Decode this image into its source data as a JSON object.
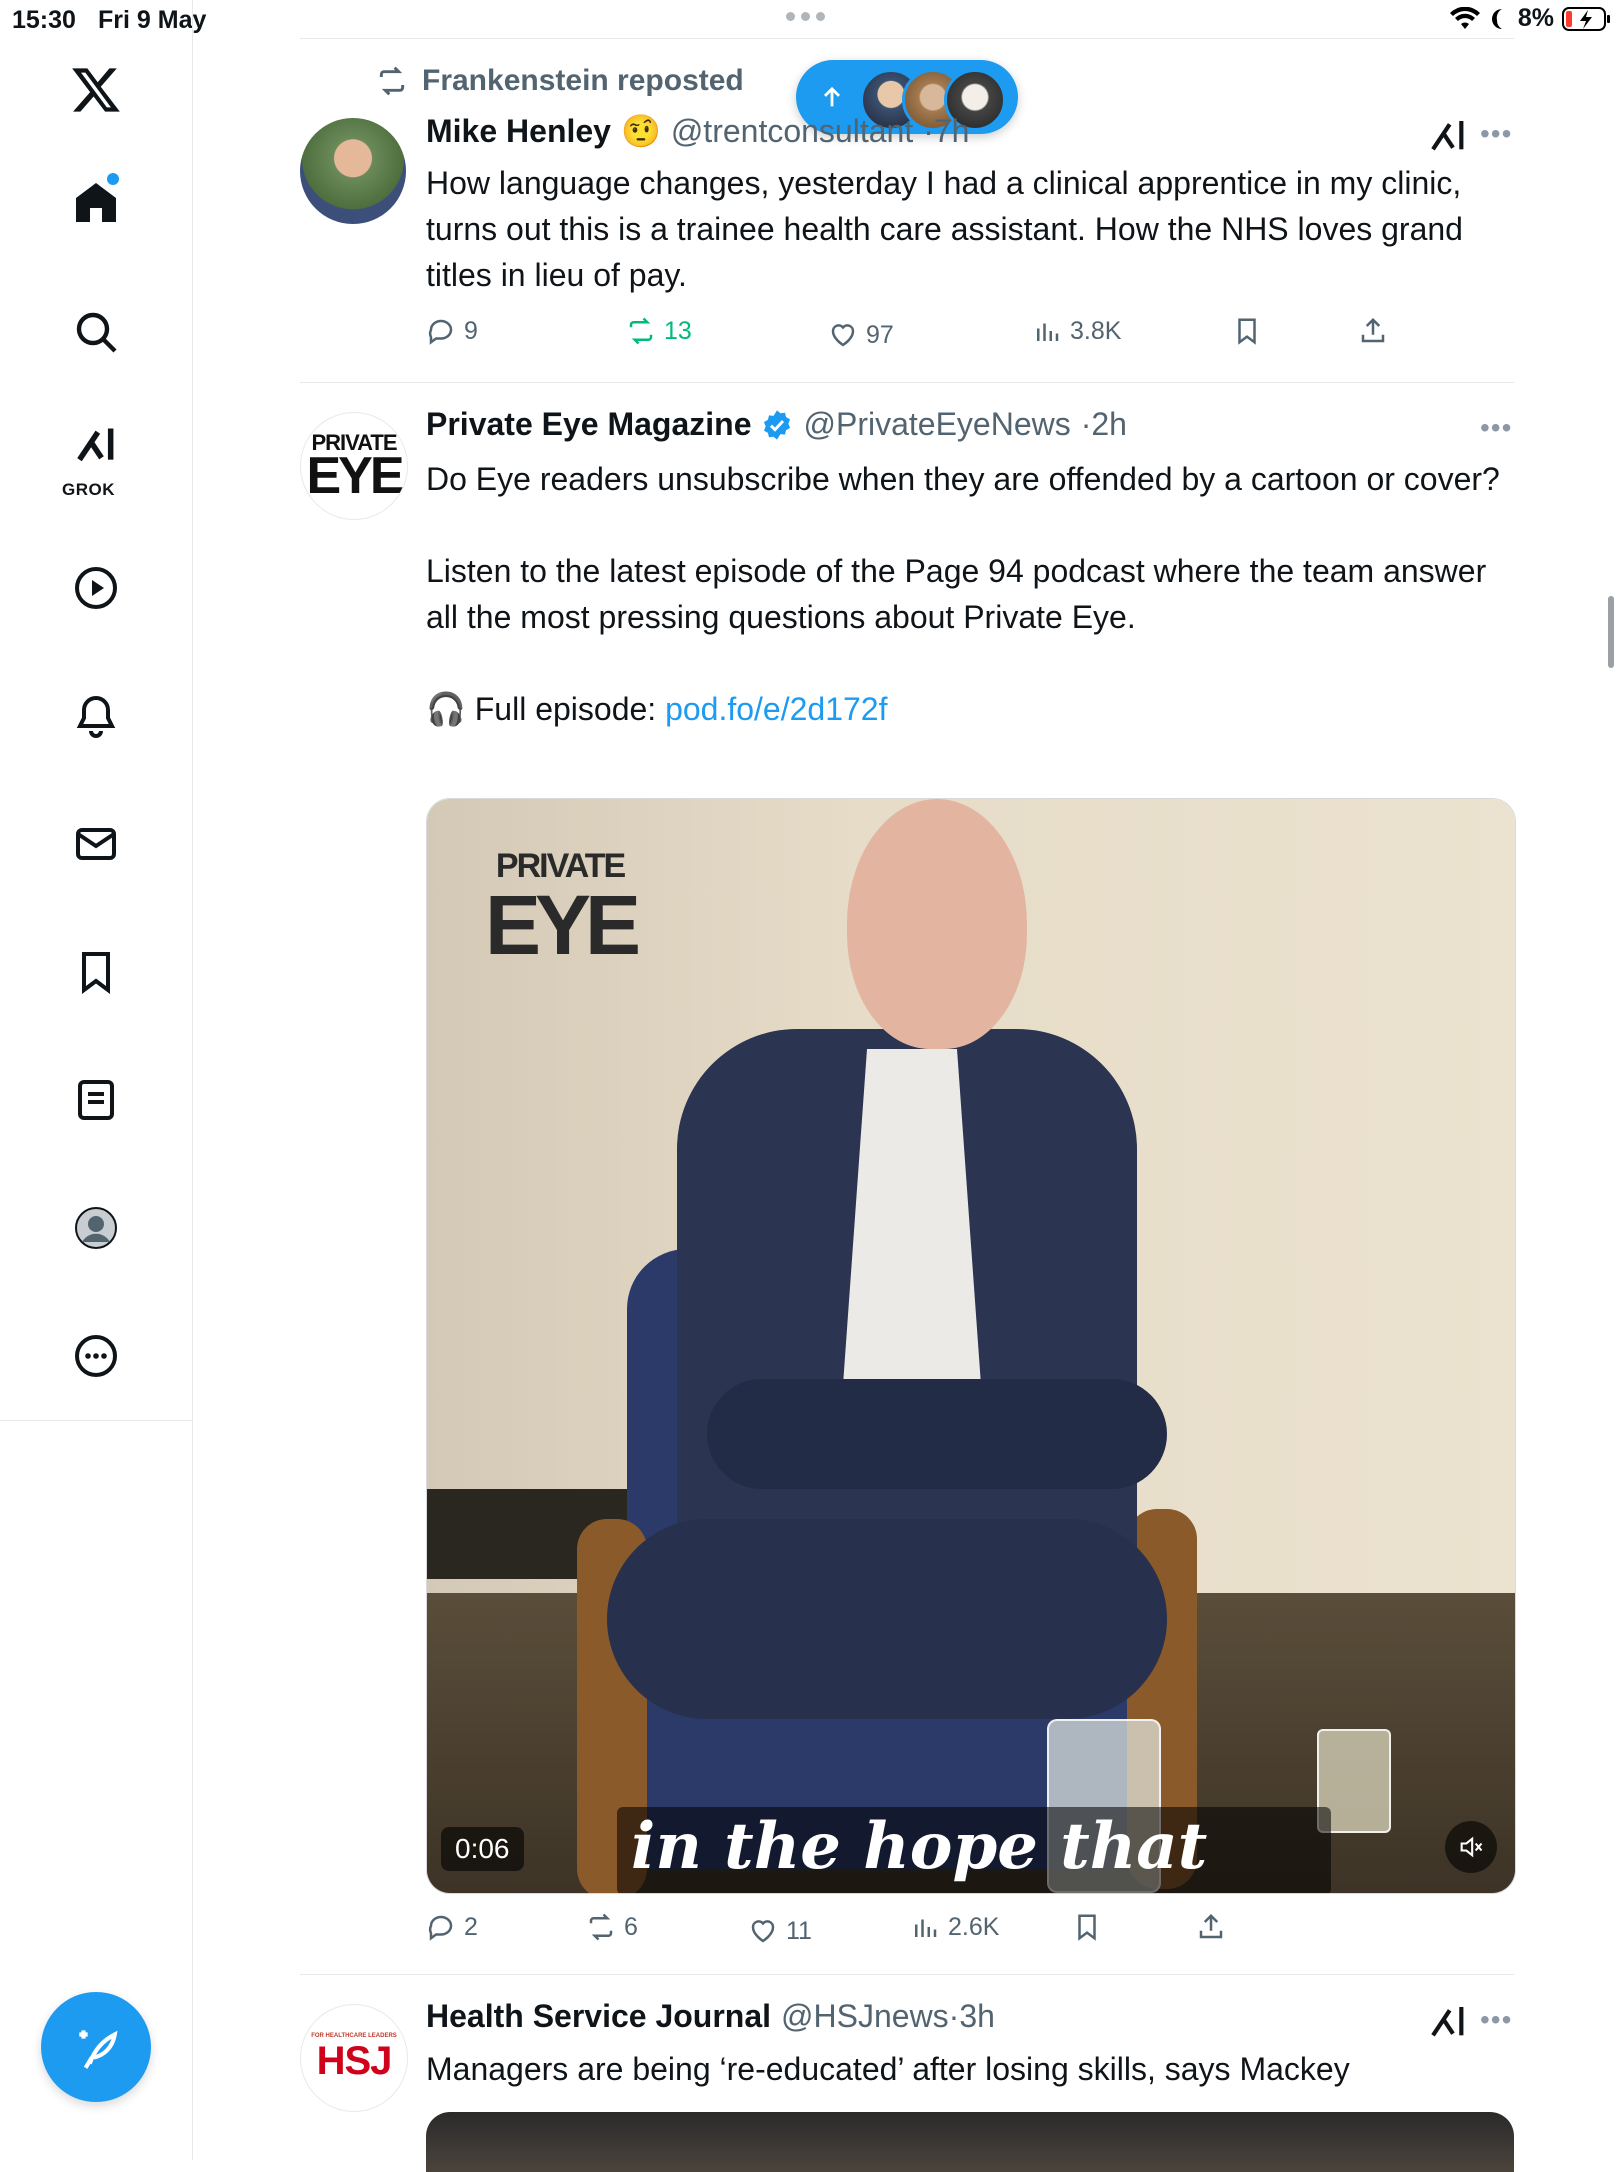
{
  "status_bar": {
    "time": "15:30",
    "date": "Fri 9 May",
    "battery": "8%"
  },
  "sidebar": {
    "grok_label": "GROK",
    "items": [
      {
        "name": "home",
        "icon": "home-icon"
      },
      {
        "name": "explore",
        "icon": "search-icon"
      },
      {
        "name": "grok",
        "icon": "grok-icon"
      },
      {
        "name": "video",
        "icon": "play-icon"
      },
      {
        "name": "notifications",
        "icon": "bell-icon"
      },
      {
        "name": "messages",
        "icon": "mail-icon"
      },
      {
        "name": "bookmarks",
        "icon": "bookmark-icon"
      },
      {
        "name": "lists",
        "icon": "list-icon"
      },
      {
        "name": "profile",
        "icon": "profile-icon"
      },
      {
        "name": "more",
        "icon": "more-circle-icon"
      }
    ],
    "compose_icon": "compose-icon"
  },
  "tweets": [
    {
      "reposted_by": "Frankenstein reposted",
      "name": "Mike Henley",
      "emoji": "🤨",
      "handle": "@trentconsultant",
      "time": "·7h",
      "text": "How language changes, yesterday I had a clinical apprentice in my clinic, turns out this is a trainee health care assistant. How the NHS loves grand titles in lieu of pay.",
      "replies": "9",
      "reposts": "13",
      "likes": "97",
      "views": "3.8K"
    },
    {
      "name": "Private Eye Magazine",
      "handle": "@PrivateEyeNews",
      "time": "·2h",
      "text_1": "Do Eye readers unsubscribe when they are offended by a cartoon or cover?",
      "text_2": "Listen to the latest episode of the Page 94 podcast where the team answer all the most pressing questions about Private Eye.",
      "episode_emoji": "🎧",
      "episode_label": "Full episode: ",
      "episode_link": "pod.fo/e/2d172f",
      "avatar_line1": "PRIVATE",
      "avatar_line2": "EYE",
      "video": {
        "duration": "0:06",
        "caption": "in the hope that their",
        "watermark_line1": "PRIVATE",
        "watermark_line2": "EYE"
      },
      "replies": "2",
      "reposts": "6",
      "likes": "11",
      "views": "2.6K"
    },
    {
      "name": "Health Service Journal",
      "handle": "@HSJnews",
      "time": "·3h",
      "text": "Managers are being ‘re-educated’ after losing skills, says Mackey",
      "avatar_text": "HSJ",
      "avatar_small": "FOR HEALTHCARE LEADERS"
    }
  ],
  "colors": {
    "accent": "#1d9bf0",
    "repost_green": "#00ba7c",
    "muted": "#536471"
  }
}
